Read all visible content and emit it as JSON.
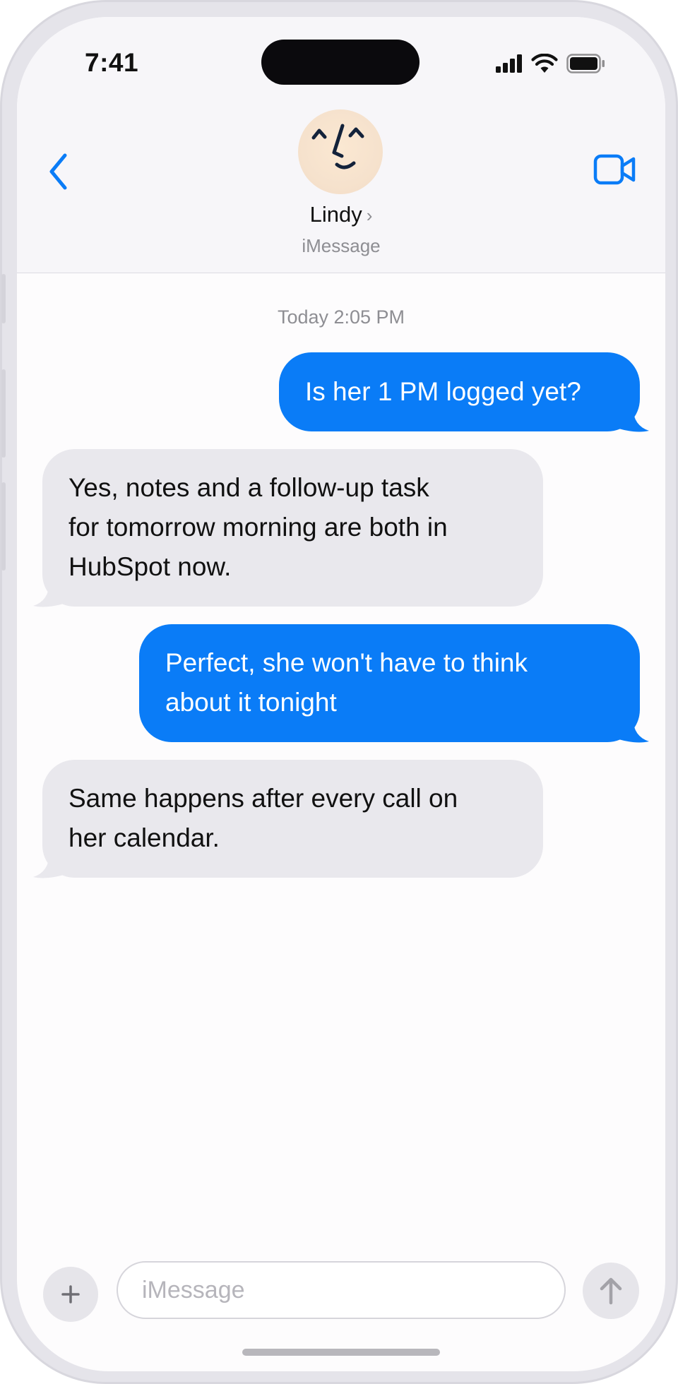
{
  "status_bar": {
    "time": "7:41",
    "icons": [
      "signal-icon",
      "wifi-icon",
      "battery-icon"
    ]
  },
  "header": {
    "back_icon": "chevron-left-icon",
    "contact_name": "Lindy",
    "name_chevron": "›",
    "service": "iMessage",
    "video_icon": "video-camera-icon",
    "avatar_icon": "smiling-face-icon"
  },
  "conversation": {
    "timestamp": "Today 2:05 PM",
    "messages": [
      {
        "direction": "outgoing",
        "text": "Is her 1 PM logged yet?"
      },
      {
        "direction": "incoming",
        "lines": [
          "Yes, notes and a follow-up task",
          "for tomorrow morning are both in",
          "HubSpot now."
        ]
      },
      {
        "direction": "outgoing",
        "lines": [
          "Perfect, she won't have to think",
          "about it tonight"
        ]
      },
      {
        "direction": "incoming",
        "lines": [
          "Same happens after every call on",
          "her calendar."
        ]
      }
    ]
  },
  "composer": {
    "plus_label": "+",
    "placeholder": "iMessage",
    "send_icon": "arrow-up-icon"
  },
  "colors": {
    "outgoing_bubble": "#0a7cf7",
    "incoming_bubble": "#e9e8ed",
    "accent": "#0a7cf7"
  }
}
